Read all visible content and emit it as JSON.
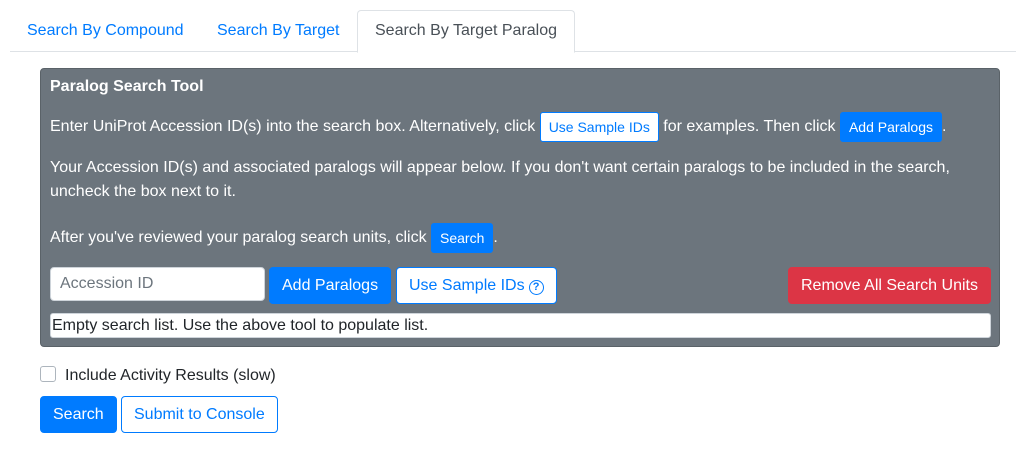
{
  "tabs": [
    {
      "label": "Search By Compound",
      "active": false
    },
    {
      "label": "Search By Target",
      "active": false
    },
    {
      "label": "Search By Target Paralog",
      "active": true
    }
  ],
  "panel": {
    "title": "Paralog Search Tool",
    "p1_before": "Enter UniProt Accession ID(s) into the search box. Alternatively, click ",
    "p1_btn1": "Use Sample IDs",
    "p1_mid": " for examples. Then click ",
    "p1_btn2": "Add Paralogs",
    "p1_after": ".",
    "p2": "Your Accession ID(s) and associated paralogs will appear below. If you don't want certain paralogs to be included in the search, uncheck the box next to it.",
    "p3_before": "After you've reviewed your paralog search units, click ",
    "p3_btn": "Search",
    "p3_after": ".",
    "input_placeholder": "Accession ID",
    "add_paralogs_label": "Add Paralogs",
    "use_sample_label": "Use Sample IDs",
    "help_icon": "question-circle-icon",
    "remove_all_label": "Remove All Search Units",
    "empty_list_text": "Empty search list. Use the above tool to populate list."
  },
  "options": {
    "include_activity_label": "Include Activity Results (slow)",
    "include_activity_checked": false
  },
  "actions": {
    "search_label": "Search",
    "submit_console_label": "Submit to Console"
  },
  "colors": {
    "primary": "#007bff",
    "panel_bg": "#6c757d",
    "danger": "#dc3545"
  }
}
